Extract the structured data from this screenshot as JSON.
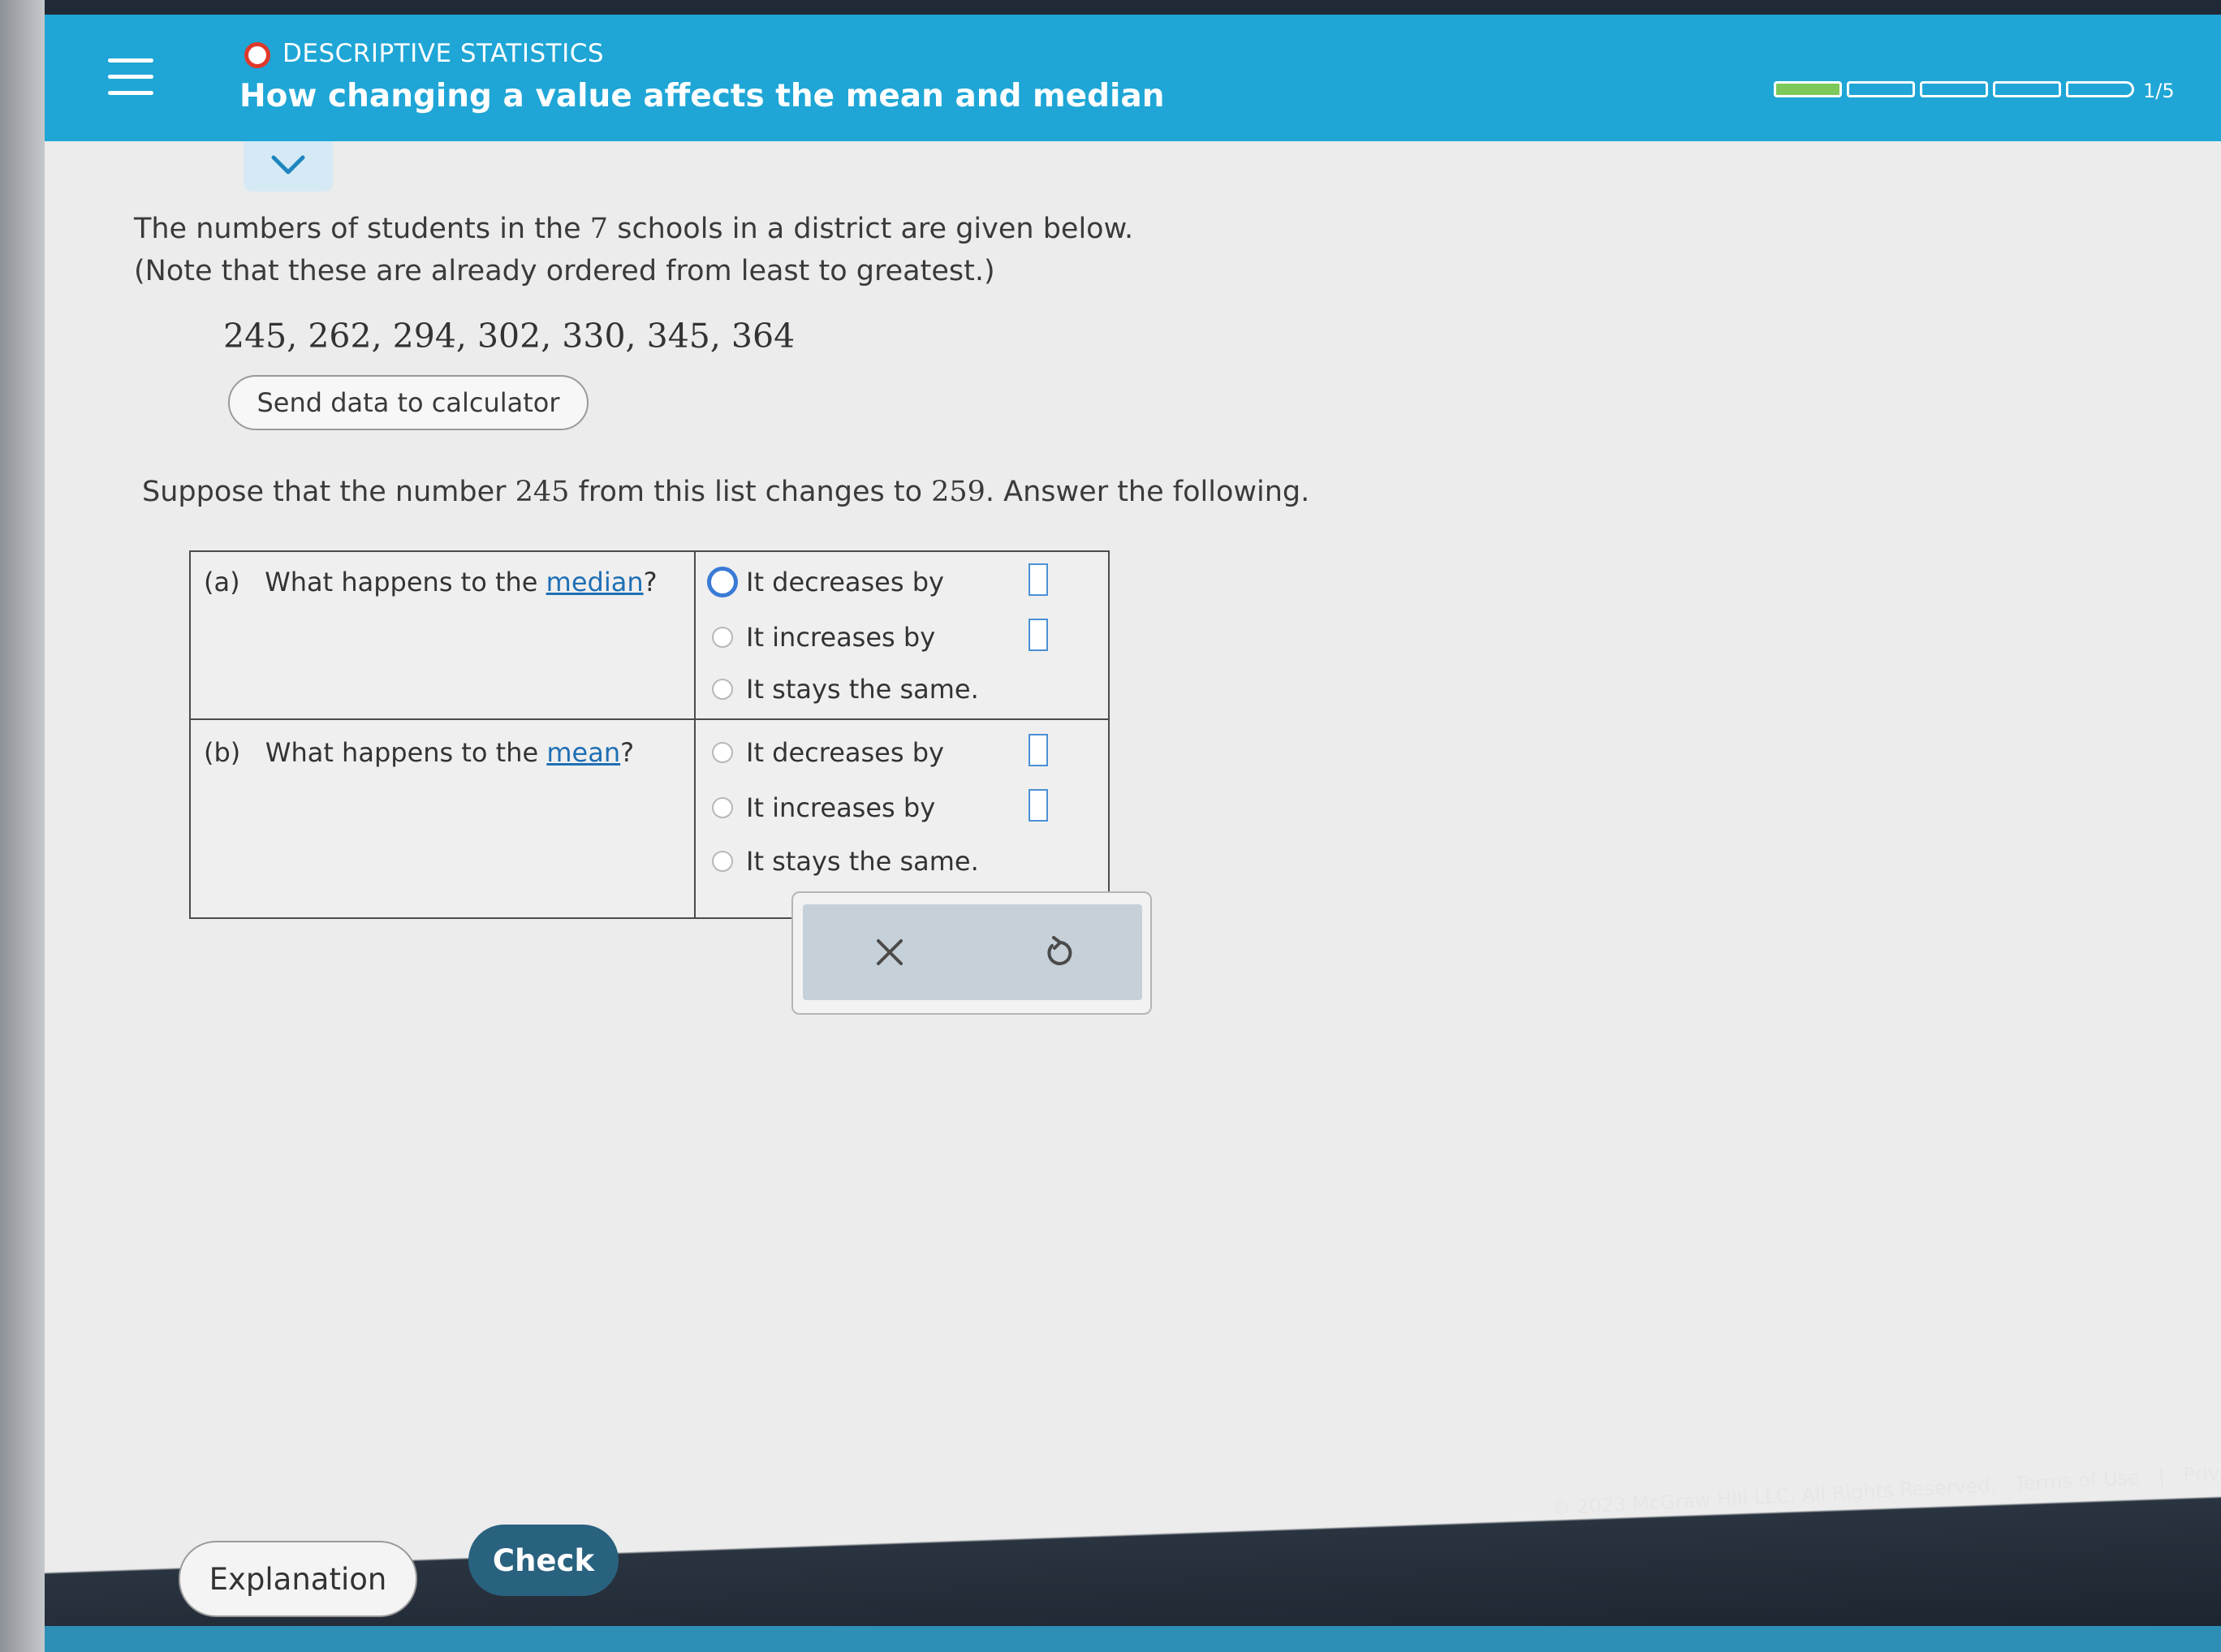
{
  "header": {
    "topic": "DESCRIPTIVE STATISTICS",
    "title": "How changing a value affects the mean and median",
    "progress": {
      "current": 1,
      "total": 5,
      "label": "1/5"
    },
    "accent_color": "#1fa6d6"
  },
  "problem": {
    "intro_line1_pre": "The numbers of students in the ",
    "intro_count": "7",
    "intro_line1_post": " schools in a district are given below.",
    "intro_line2": "(Note that these are already ordered from least to greatest.)",
    "dataset": "245, 262, 294, 302, 330, 345, 364",
    "send_button": "Send data to calculator",
    "suppose_pre": "Suppose that the number ",
    "old_value": "245",
    "suppose_mid": " from this list changes to ",
    "new_value": "259",
    "suppose_post": ". Answer the following."
  },
  "questions": [
    {
      "letter": "(a)",
      "text_pre": "What happens to the ",
      "link": "median",
      "text_post": "?",
      "options": [
        "It decreases by",
        "It increases by",
        "It stays the same."
      ],
      "selected_index": 0
    },
    {
      "letter": "(b)",
      "text_pre": "What happens to the ",
      "link": "mean",
      "text_post": "?",
      "options": [
        "It decreases by",
        "It increases by",
        "It stays the same."
      ],
      "selected_index": null
    }
  ],
  "actions": {
    "clear_icon": "close-icon",
    "undo_icon": "undo-icon"
  },
  "footer": {
    "explanation": "Explanation",
    "check": "Check",
    "copyright": "© 2023 McGraw Hill LLC. All Rights Reserved.",
    "terms": "Terms of Use",
    "separator": "|",
    "privacy": "Privacy"
  }
}
